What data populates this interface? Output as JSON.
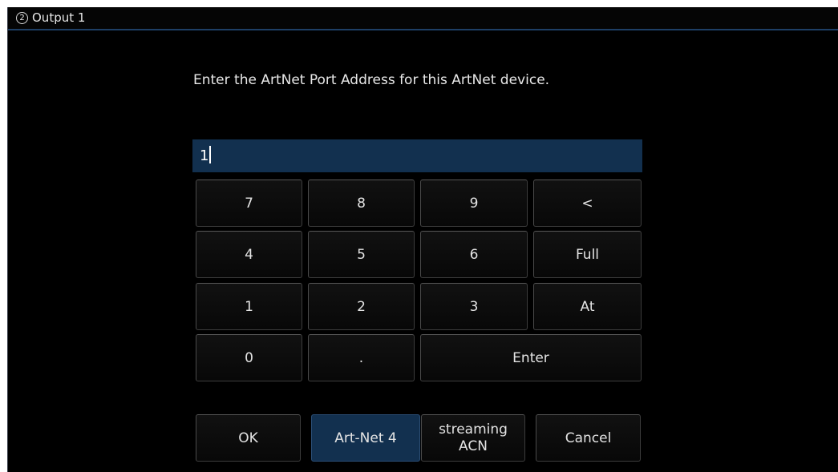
{
  "window": {
    "number": "2",
    "title": "Output 1"
  },
  "prompt": "Enter the ArtNet Port Address for this ArtNet device.",
  "entry": {
    "value": "1"
  },
  "keypad": {
    "k7": "7",
    "k8": "8",
    "k9": "9",
    "back": "<",
    "k4": "4",
    "k5": "5",
    "k6": "6",
    "full": "Full",
    "k1": "1",
    "k2": "2",
    "k3": "3",
    "at": "At",
    "k0": "0",
    "dot": ".",
    "enter": "Enter"
  },
  "footer": {
    "ok": "OK",
    "artnet4": "Art-Net 4",
    "sacn_line1": "streaming",
    "sacn_line2": "ACN",
    "cancel": "Cancel",
    "selected_protocol": "Art-Net 4"
  },
  "colors": {
    "background": "#000000",
    "accent": "#12304f",
    "title_rule": "#1e3f66",
    "text": "#e4e4e4"
  }
}
